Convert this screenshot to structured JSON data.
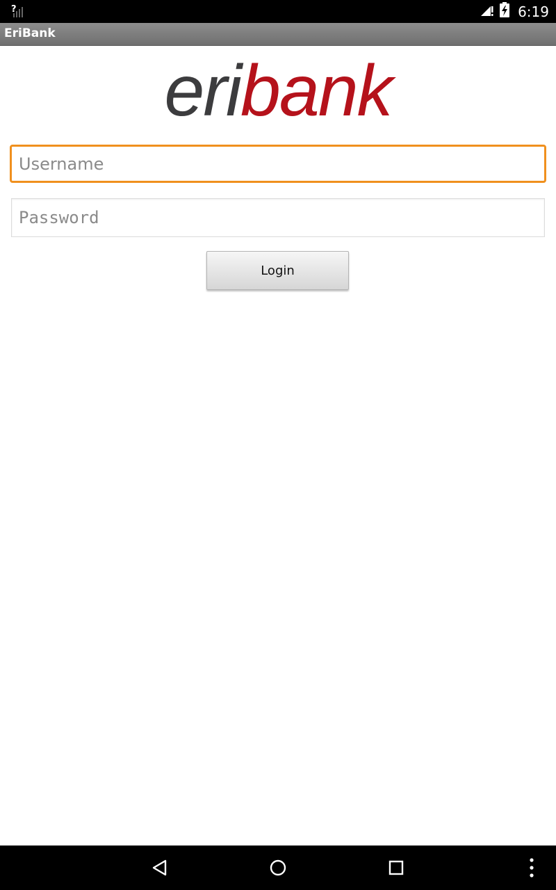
{
  "status_bar": {
    "time": "6:19",
    "icons": [
      "no-sim-signal-icon",
      "cell-signal-icon",
      "battery-charging-icon"
    ]
  },
  "app": {
    "title": "EriBank"
  },
  "logo": {
    "part1": "eri",
    "part2": "bank",
    "color_eri": "#3c3c3e",
    "color_bank": "#b5121b"
  },
  "form": {
    "username_placeholder": "Username",
    "username_value": "",
    "password_placeholder": "Password",
    "password_value": "",
    "login_label": "Login"
  },
  "nav_bar": {
    "icons": [
      "back-icon",
      "home-icon",
      "recents-icon",
      "overflow-menu-icon"
    ]
  },
  "colors": {
    "focus_accent": "#f0901e"
  }
}
